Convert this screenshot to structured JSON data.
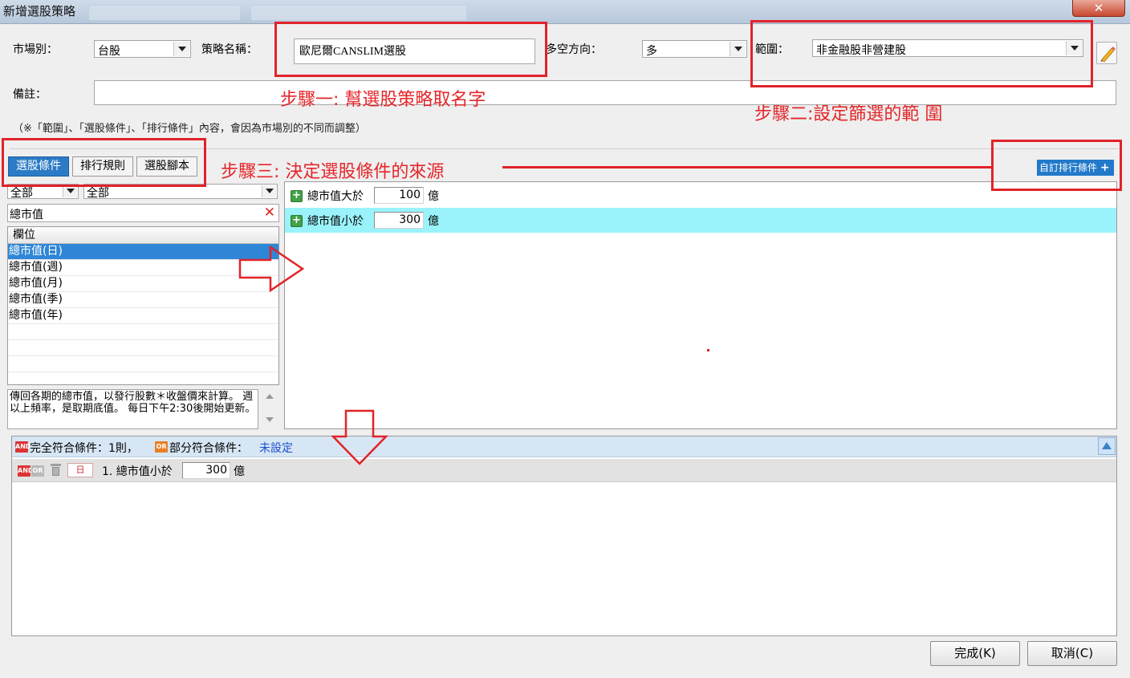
{
  "window": {
    "title": "新增選股策略",
    "close_symbol": "✕"
  },
  "form": {
    "market_label": "市場別：",
    "market_value": "台股",
    "strategy_name_label": "策略名稱：",
    "strategy_name_value": "歐尼爾CANSLIM選股",
    "direction_label": "多空方向：",
    "direction_value": "多",
    "scope_label": "範圍：",
    "scope_value": "非金融股非營建股",
    "remark_label": "備註：",
    "remark_value": "",
    "note": "（※「範圍」、「選股條件」、「排行條件」內容，會因為市場別的不同而調整）"
  },
  "annotations": {
    "step1": "步驟一: 幫選股策略取名字",
    "step2": "步驟二:設定篩選的範 圍",
    "step3": "步驟三: 決定選股條件的來源"
  },
  "tabs": [
    {
      "label": "選股條件",
      "active": true
    },
    {
      "label": "排行規則",
      "active": false
    },
    {
      "label": "選股腳本",
      "active": false
    }
  ],
  "custom_rank_button": "自訂排行條件",
  "left_panel": {
    "filter1": "全部",
    "filter2": "全部",
    "search_value": "總市值",
    "list_header": "欄位",
    "items": [
      "總市值(日)",
      "總市值(週)",
      "總市值(月)",
      "總市值(季)",
      "總市值(年)"
    ],
    "selected_index": 0,
    "description": "傳回各期的總市值，以發行股數＊收盤價來計算。 週以上頻率，是取期底值。 每日下午2:30後開始更新。"
  },
  "conditions": [
    {
      "label": "總市值大於",
      "value": "100",
      "unit": "億",
      "highlighted": false
    },
    {
      "label": "總市值小於",
      "value": "300",
      "unit": "億",
      "highlighted": true
    }
  ],
  "summary": {
    "and_tag": "AND",
    "or_tag": "OR",
    "full_match_text": "完全符合條件：1則，",
    "partial_match_label": "部分符合條件：",
    "partial_match_value": "未設定",
    "row": {
      "day_label": "日",
      "label": "1. 總市值小於",
      "value": "300",
      "unit": "億"
    }
  },
  "buttons": {
    "ok": "完成(K)",
    "cancel": "取消(C)"
  },
  "colors": {
    "annotation_red": "#e5262a",
    "tab_active": "#2c7bc6",
    "highlight_row": "#9af3fb"
  }
}
